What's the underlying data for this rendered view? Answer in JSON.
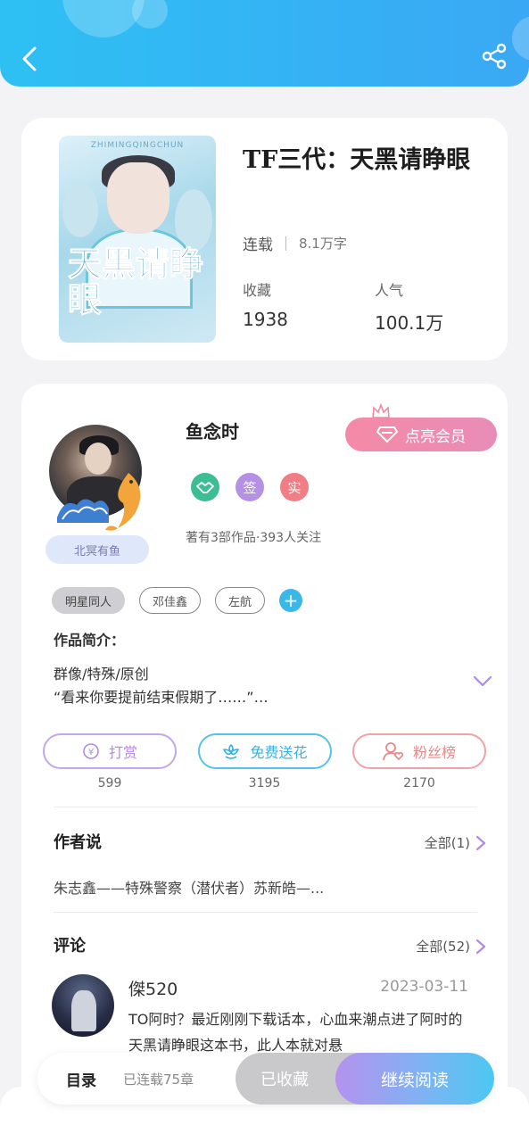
{
  "header": {
    "back_icon": "chevron-left-icon",
    "share_icon": "share-icon",
    "gradient": [
      "#2ec0f3",
      "#3aa8f4"
    ]
  },
  "book": {
    "cover_top_text": "ZHIMINGQINGCHUN",
    "cover_title": "天黑请睁眼",
    "title": "TF三代：天黑请睁眼",
    "status": "连载",
    "words": "8.1万字",
    "collect_label": "收藏",
    "collect_value": "1938",
    "popularity_label": "人气",
    "popularity_value": "100.1万"
  },
  "author": {
    "name": "鱼念时",
    "nickname_badge": "北冥有鱼",
    "vip_button": "点亮会员",
    "badges": [
      {
        "icon": "handshake-icon",
        "text": "",
        "color": "#3dbd93"
      },
      {
        "icon": "",
        "text": "签",
        "color": "#b591e6"
      },
      {
        "icon": "",
        "text": "实",
        "color": "#f17e84"
      }
    ],
    "meta": "著有3部作品·393人关注"
  },
  "tags": {
    "t1": "明星同人",
    "t2": "邓佳鑫",
    "t3": "左航",
    "add_icon": "plus-icon"
  },
  "intro": {
    "label": "作品简介：",
    "line1": "群像/特殊/原创",
    "line2": "“看来你要提前结束假期了……”…"
  },
  "actions": {
    "reward": {
      "label": "打赏",
      "count": "599",
      "icon": "yen-coin-icon"
    },
    "flower": {
      "label": "免费送花",
      "count": "3195",
      "icon": "flower-icon"
    },
    "fans": {
      "label": "粉丝榜",
      "count": "2170",
      "icon": "user-heart-icon"
    }
  },
  "author_says": {
    "title": "作者说",
    "more": "全部(1)",
    "text": "朱志鑫——特殊警察（潜伏者）苏新皓—..."
  },
  "comments": {
    "title": "评论",
    "more": "全部(52)",
    "user": "傑520",
    "date": "2023-03-11",
    "text": "TO阿时？最近刚刚下载话本，心血来潮点进了阿时的天黑请睁眼这本书，此人本就对悬"
  },
  "bottom": {
    "toc": "目录",
    "chapters": "已连载75章",
    "collected": "已收藏",
    "continue": "继续阅读"
  }
}
